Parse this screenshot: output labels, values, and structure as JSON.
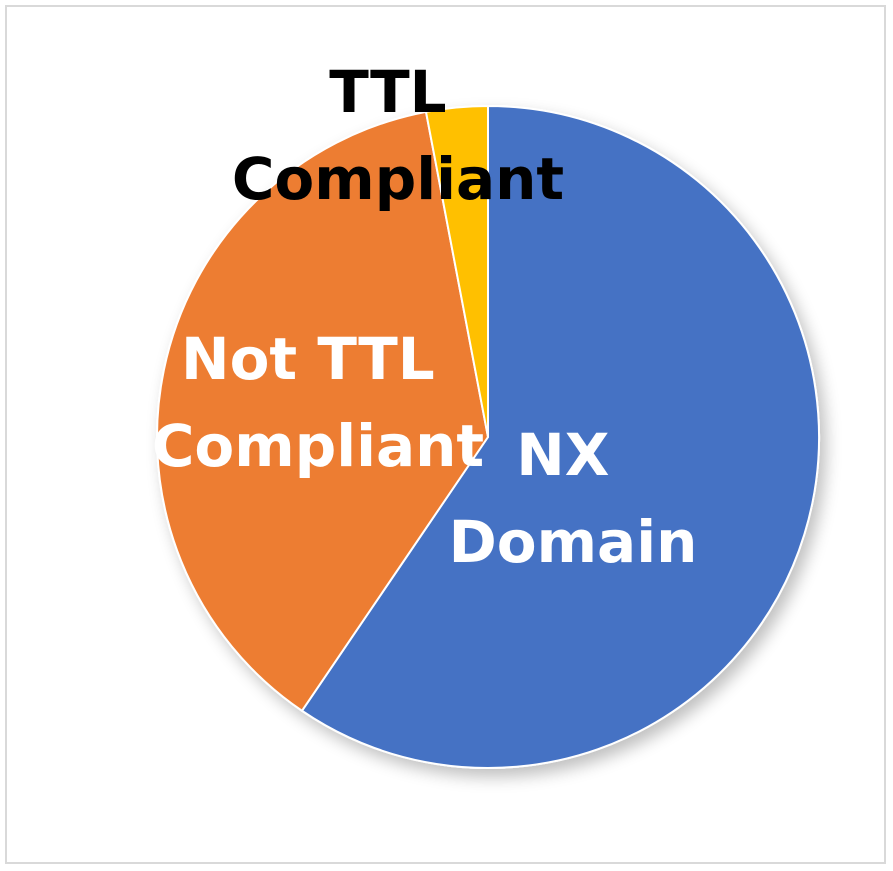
{
  "chart_data": {
    "type": "pie",
    "start_angle_deg": 0,
    "direction": "clockwise",
    "slices": [
      {
        "label_lines": [
          "NX",
          "Domain"
        ],
        "value": 59.5,
        "color": "#4472C4",
        "label_color": "#FFFFFF"
      },
      {
        "label_lines": [
          "Not TTL",
          "Compliant"
        ],
        "value": 37.5,
        "color": "#ED7D31",
        "label_color": "#FFFFFF"
      },
      {
        "label_lines": [
          "TTL",
          "Compliant"
        ],
        "value": 3.0,
        "color": "#FFC000",
        "label_color": "#000000"
      }
    ],
    "title": "",
    "legend": "none"
  }
}
